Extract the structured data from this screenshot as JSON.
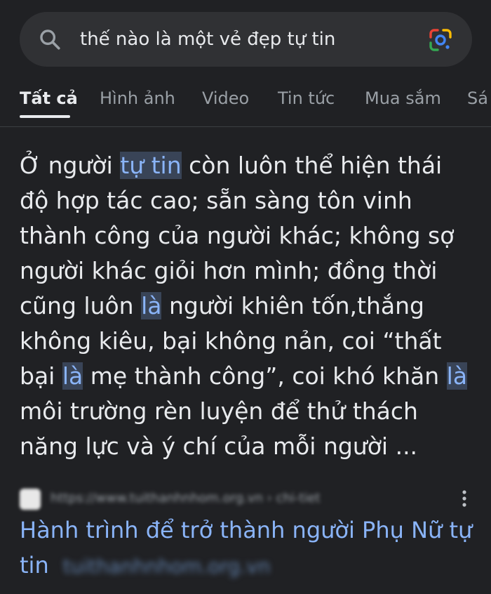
{
  "search": {
    "query": "thế nào là một vẻ đẹp tự tin",
    "search_icon": "search-icon",
    "lens_icon": "google-lens-icon"
  },
  "tabs": [
    {
      "label": "Tất cả",
      "active": true
    },
    {
      "label": "Hình ảnh",
      "active": false
    },
    {
      "label": "Video",
      "active": false
    },
    {
      "label": "Tin tức",
      "active": false
    },
    {
      "label": "Mua sắm",
      "active": false
    },
    {
      "label": "Sá",
      "active": false
    }
  ],
  "snippet": {
    "segments": [
      {
        "text": "Ở người ",
        "hl": false
      },
      {
        "text": "tự tin",
        "hl": true
      },
      {
        "text": " còn luôn thể hiện thái độ hợp tác cao; sẵn sàng tôn vinh thành công của người khác; không sợ người khác giỏi hơn mình; đồng thời cũng luôn ",
        "hl": false
      },
      {
        "text": "là",
        "hl": true
      },
      {
        "text": " người khiên tốn,thắng không kiêu, bại không nản, coi “thất bại ",
        "hl": false
      },
      {
        "text": "là",
        "hl": true
      },
      {
        "text": " mẹ thành công”, coi khó khăn ",
        "hl": false
      },
      {
        "text": "là",
        "hl": true
      },
      {
        "text": " môi trường rèn luyện để thử thách năng lực và ý chí của mỗi người ...",
        "hl": false
      }
    ]
  },
  "result": {
    "source_url": "https://www.tuithanhnhom.org.vn › chi-tiet",
    "title": "Hành trình để trở thành người Phụ Nữ tự tin",
    "domain_blurred": "tuithanhnhom.org.vn",
    "menu_icon": "more-vert-icon"
  },
  "colors": {
    "background": "#202124",
    "search_bar": "#303134",
    "text": "#e8eaed",
    "muted": "#9aa0a6",
    "link": "#8ab4f8",
    "highlight_bg": "#394457"
  }
}
